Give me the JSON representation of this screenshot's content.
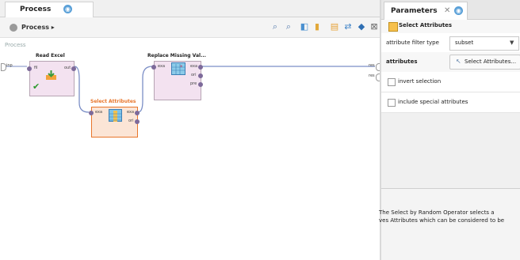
{
  "process_tab": {
    "label": "Process",
    "help_icon": "help-icon"
  },
  "toolbar": {
    "crumb": "Process ▸"
  },
  "canvas": {
    "section_label": "Process",
    "in_port": "inp",
    "res_ports": [
      "res",
      "res"
    ]
  },
  "operators": {
    "read_excel": {
      "title": "Read Excel",
      "ports": {
        "in": "fil",
        "out": "out"
      }
    },
    "select_attributes": {
      "title": "Select Attributes",
      "ports": {
        "in": "exa",
        "out1": "exa",
        "out2": "ori"
      }
    },
    "replace_missing": {
      "title": "Replace Missing Val...",
      "ports": {
        "in": "exa",
        "out1": "exa",
        "out2": "ori",
        "out3": "pre"
      }
    }
  },
  "parameters": {
    "tab_label": "Parameters",
    "close": "✕",
    "operator_name": "Select Attributes",
    "filter_type_label": "attribute filter type",
    "filter_type_value": "subset",
    "attributes_label": "attributes",
    "select_button": "Select Attributes...",
    "invert_label": "invert selection",
    "special_label": "include special attributes"
  },
  "help": {
    "line1": "The Select by Random Operator selects a",
    "line2": "ves Attributes which can be considered to be"
  },
  "colors": {
    "accent": "#e8752a",
    "operator_fill": "#f3e2f0",
    "selected_fill": "#fbe5d6",
    "link": "#7b8ec6"
  }
}
